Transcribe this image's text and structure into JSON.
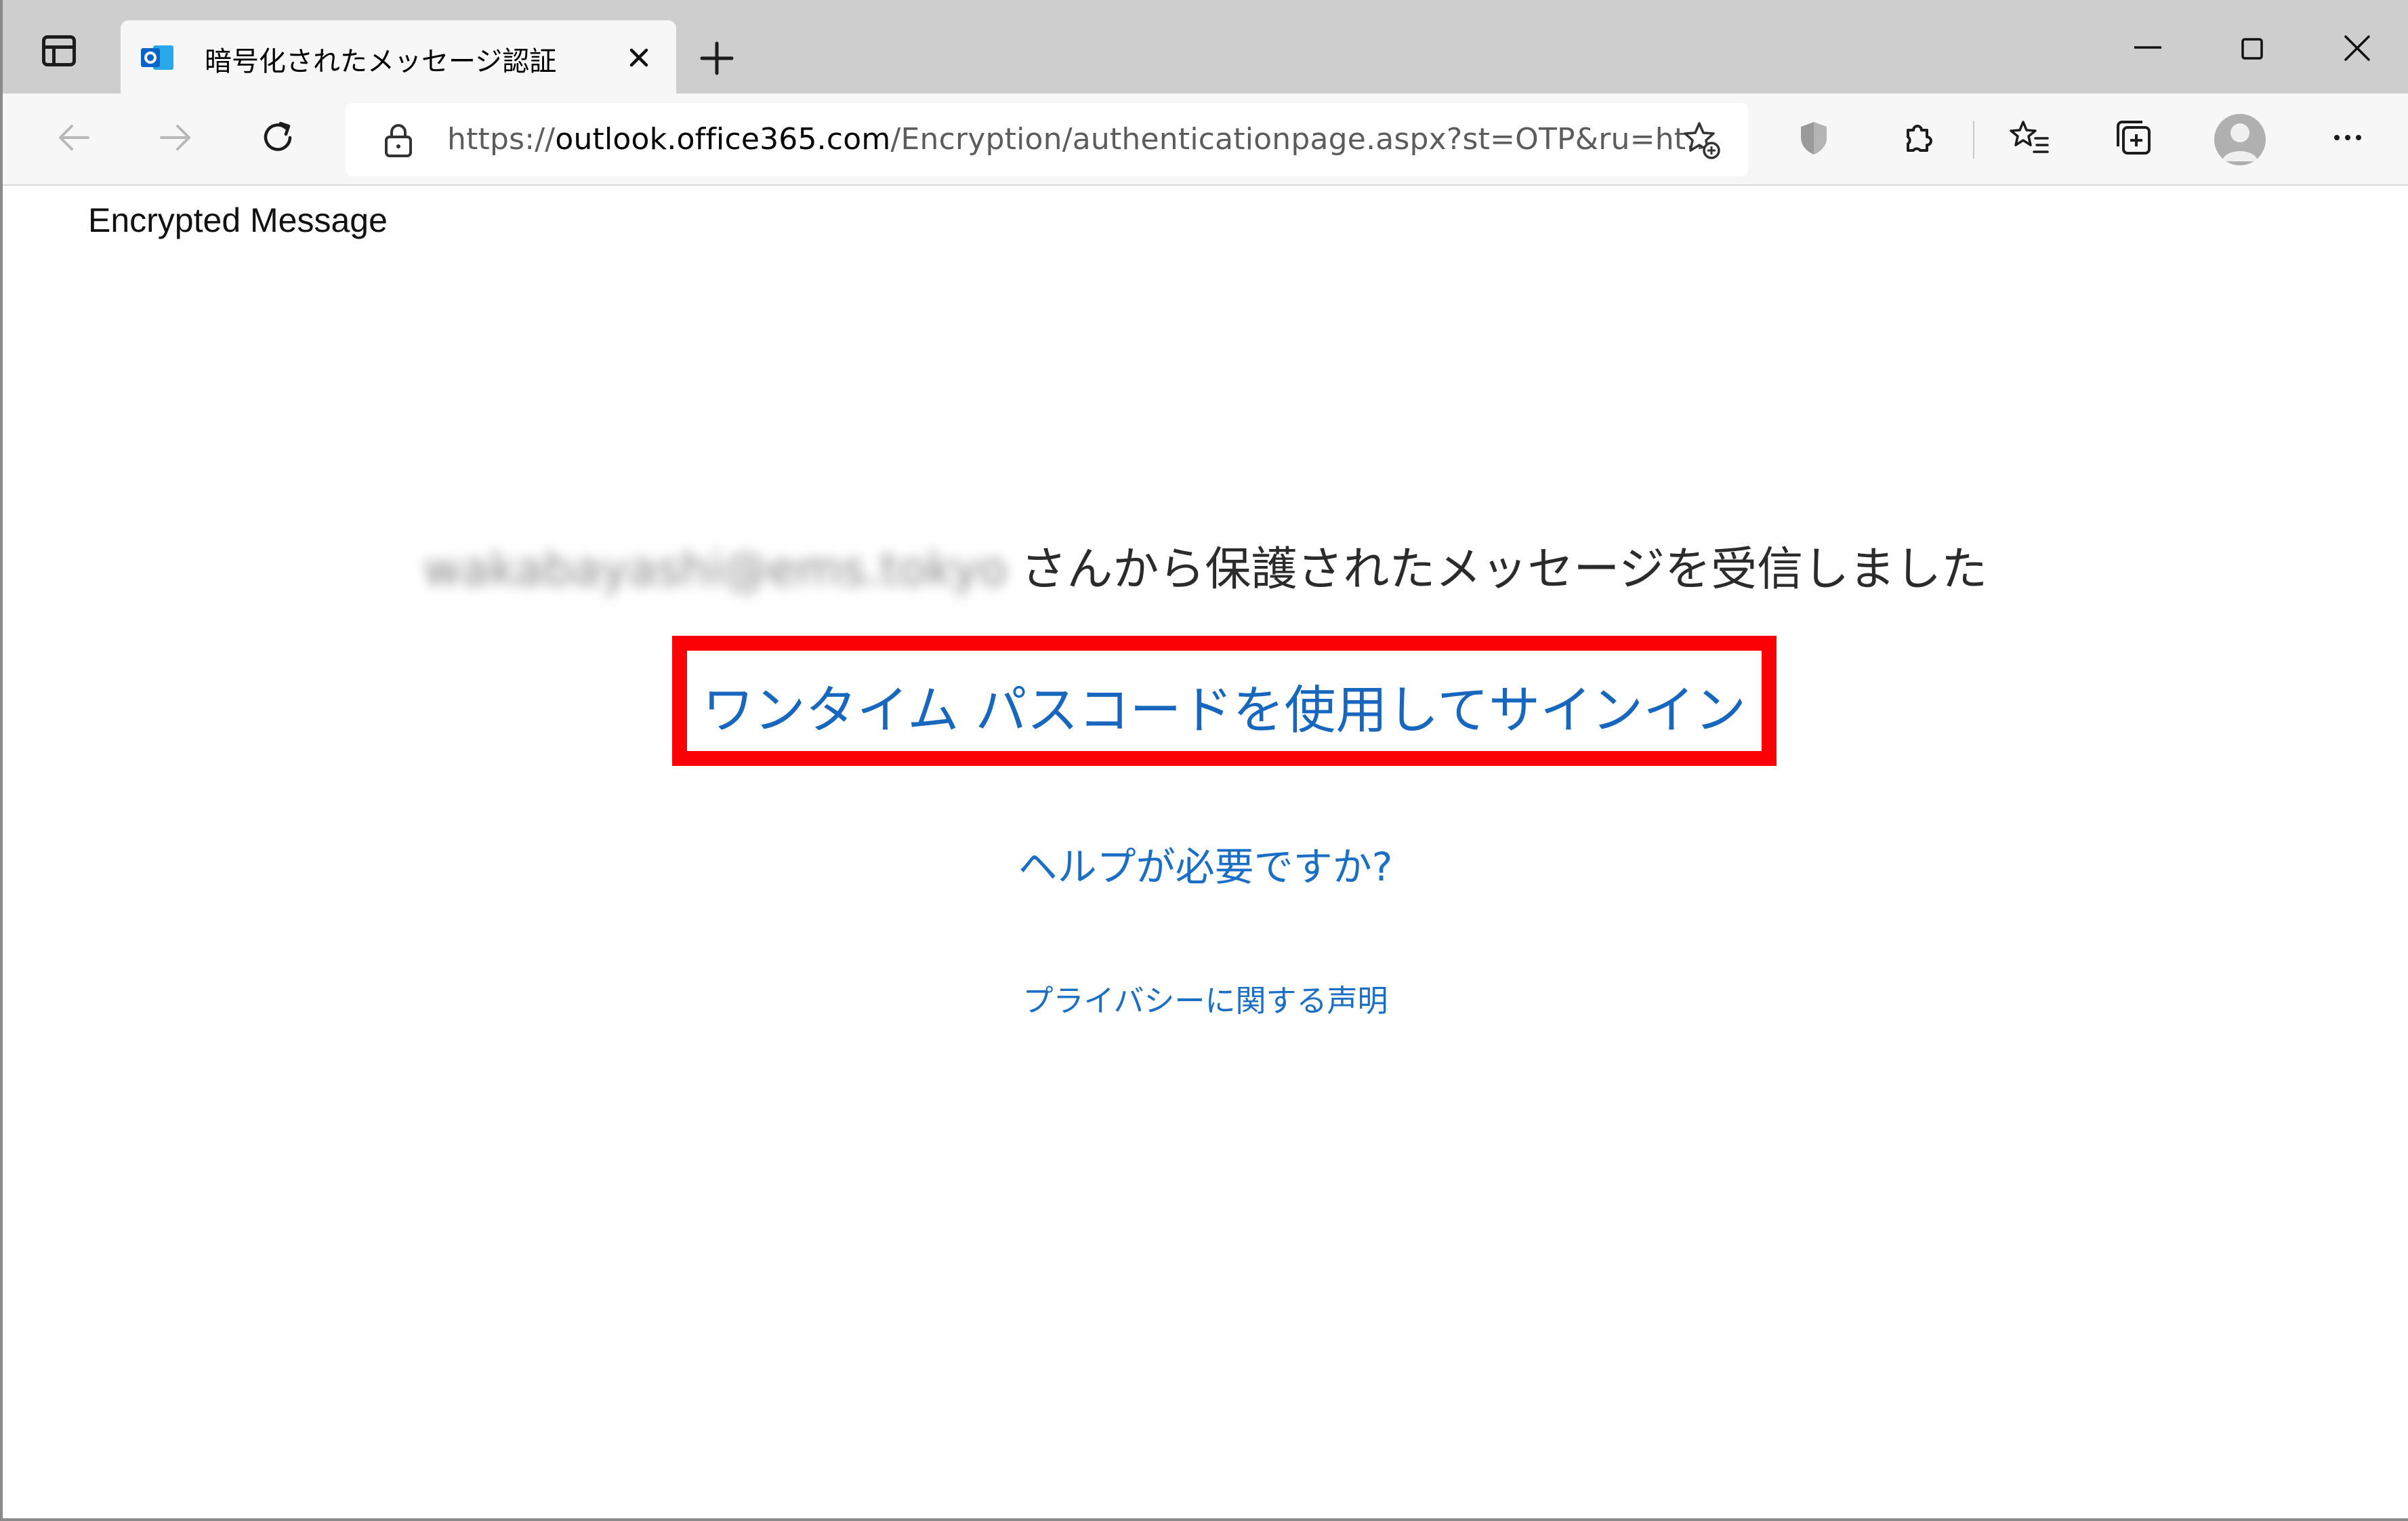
{
  "browser": {
    "tab": {
      "title": "暗号化されたメッセージ認証",
      "favicon": "outlook-icon"
    },
    "toolbar": {
      "url_scheme": "https://",
      "url_domain": "outlook.office365.com",
      "url_path": "/Encryption/authenticationpage.aspx?st=OTP&ru=ht..."
    },
    "icons": [
      "tab-actions-icon",
      "close-icon",
      "plus-icon",
      "minimize-icon",
      "maximize-icon",
      "window-close-icon",
      "back-arrow-icon",
      "forward-arrow-icon",
      "refresh-icon",
      "lock-icon",
      "add-favorite-icon",
      "shield-icon",
      "extensions-icon",
      "favorites-icon",
      "collections-icon",
      "profile-avatar",
      "more-icon"
    ]
  },
  "page": {
    "header": "Encrypted Message",
    "sender_email": "wakabayashi@ems.tokyo",
    "sender_suffix": "さんから保護されたメッセージを受信しました",
    "signin_link": "ワンタイム パスコードを使用してサインイン",
    "help_link": "ヘルプが必要ですか?",
    "privacy_link": "プライバシーに関する声明"
  },
  "colors": {
    "link": "#1867bf",
    "highlight_border": "#fb0106",
    "tabstrip": "#cecece"
  }
}
